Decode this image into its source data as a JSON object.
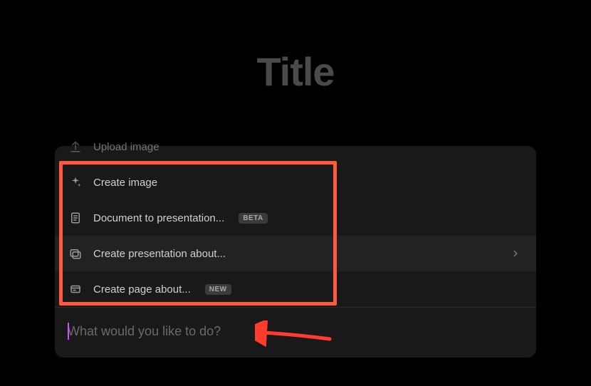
{
  "title": "Title",
  "menu": {
    "upload_image": {
      "label": "Upload image"
    },
    "create_image": {
      "label": "Create image"
    },
    "doc_to_presentation": {
      "label": "Document to presentation...",
      "badge": "BETA"
    },
    "create_presentation": {
      "label": "Create presentation about..."
    },
    "create_page": {
      "label": "Create page about...",
      "badge": "NEW"
    }
  },
  "input": {
    "placeholder": "What would you like to do?"
  }
}
